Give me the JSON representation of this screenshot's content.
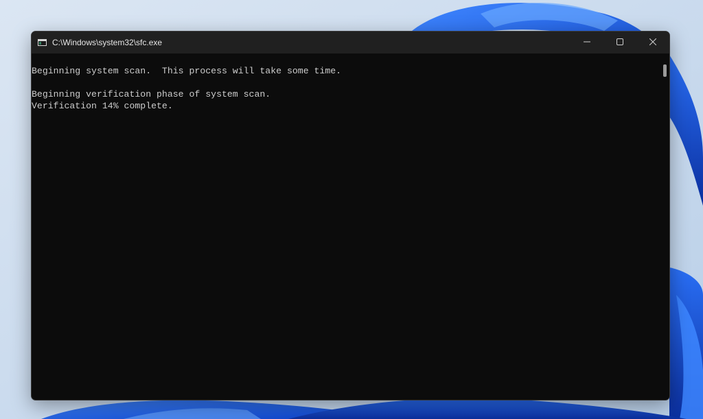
{
  "window": {
    "title": "C:\\Windows\\system32\\sfc.exe",
    "icons": {
      "app": "console-app-icon",
      "minimize": "minimize-icon",
      "maximize": "maximize-icon",
      "close": "close-icon"
    }
  },
  "console": {
    "lines": [
      "Beginning system scan.  This process will take some time.",
      "",
      "Beginning verification phase of system scan.",
      "Verification 14% complete."
    ]
  },
  "colors": {
    "console_background": "#0c0c0c",
    "console_text": "#cccccc",
    "titlebar_background": "#202020",
    "wallpaper_accent": "#1f5fe0"
  }
}
